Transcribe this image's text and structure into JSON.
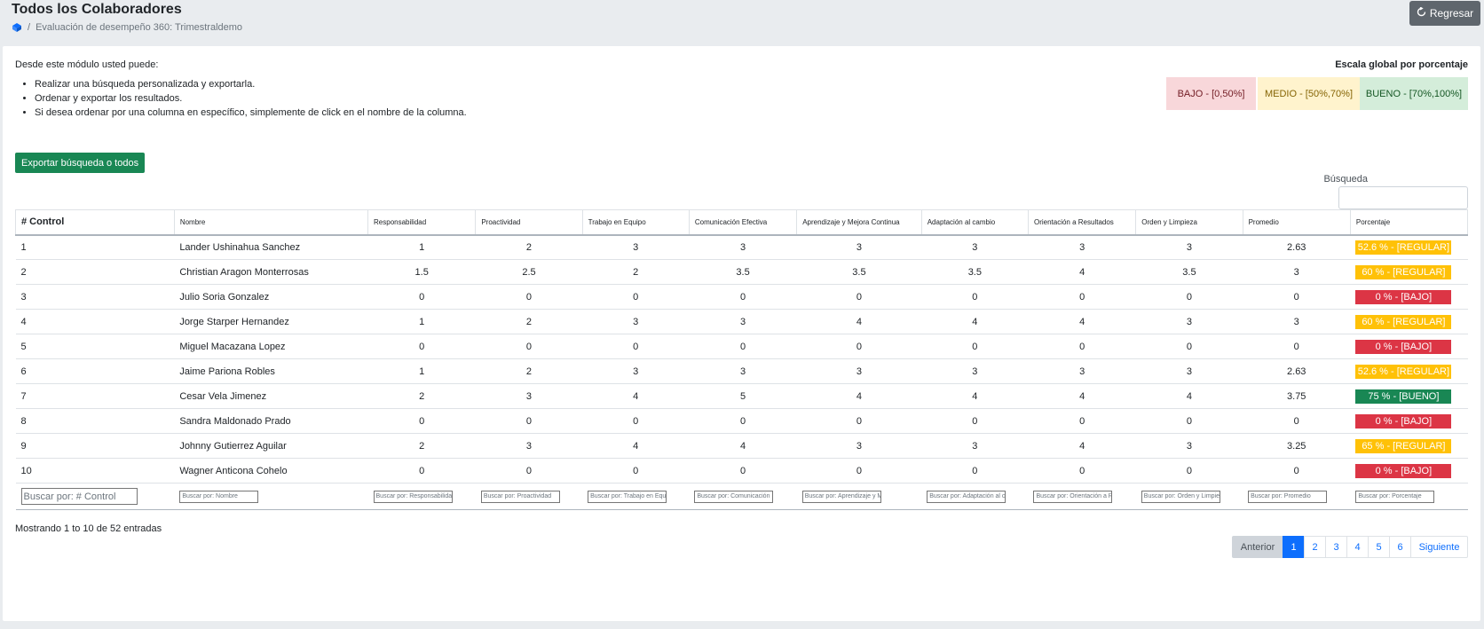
{
  "header": {
    "title": "Todos los Colaboradores",
    "breadcrumb": "Evaluación de desempeño 360: Trimestraldemo",
    "back_label": "Regresar"
  },
  "intro": {
    "lead": "Desde este módulo usted puede:",
    "items": [
      "Realizar una búsqueda personalizada y exportarla.",
      "Ordenar y exportar los resultados.",
      "Si desea ordenar por una columna en específico, simplemente de click en el nombre de la columna."
    ]
  },
  "scale": {
    "title": "Escala global por porcentaje",
    "bajo": "BAJO - [0,50%]",
    "medio": "MEDIO - [50%,70%]",
    "bueno": "BUENO - [70%,100%]",
    "colors": {
      "bajo": "#f8d7da",
      "medio": "#fff3cd",
      "bueno": "#d4edda"
    }
  },
  "export_label": "Exportar búsqueda o todos",
  "search": {
    "label": "Búsqueda",
    "value": ""
  },
  "table": {
    "columns": [
      "# Control",
      "Nombre",
      "Responsabilidad",
      "Proactividad",
      "Trabajo en Equipo",
      "Comunicación Efectiva",
      "Aprendizaje y Mejora Continua",
      "Adaptación al cambio",
      "Orientación a Resultados",
      "Orden y Limpieza",
      "Promedio",
      "Porcentaje"
    ],
    "rows": [
      [
        "1",
        "Lander Ushinahua Sanchez",
        "1",
        "2",
        "3",
        "3",
        "3",
        "3",
        "3",
        "3",
        "2.63",
        "52.6 % - [REGULAR]"
      ],
      [
        "2",
        "Christian Aragon Monterrosas",
        "1.5",
        "2.5",
        "2",
        "3.5",
        "3.5",
        "3.5",
        "4",
        "3.5",
        "3",
        "60 % - [REGULAR]"
      ],
      [
        "3",
        "Julio Soria Gonzalez",
        "0",
        "0",
        "0",
        "0",
        "0",
        "0",
        "0",
        "0",
        "0",
        "0 % - [BAJO]"
      ],
      [
        "4",
        "Jorge Starper Hernandez",
        "1",
        "2",
        "3",
        "3",
        "4",
        "4",
        "4",
        "3",
        "3",
        "60 % - [REGULAR]"
      ],
      [
        "5",
        "Miguel Macazana Lopez",
        "0",
        "0",
        "0",
        "0",
        "0",
        "0",
        "0",
        "0",
        "0",
        "0 % - [BAJO]"
      ],
      [
        "6",
        "Jaime Pariona Robles",
        "1",
        "2",
        "3",
        "3",
        "3",
        "3",
        "3",
        "3",
        "2.63",
        "52.6 % - [REGULAR]"
      ],
      [
        "7",
        "Cesar Vela Jimenez",
        "2",
        "3",
        "4",
        "5",
        "4",
        "4",
        "4",
        "4",
        "3.75",
        "75 % - [BUENO]"
      ],
      [
        "8",
        "Sandra Maldonado Prado",
        "0",
        "0",
        "0",
        "0",
        "0",
        "0",
        "0",
        "0",
        "0",
        "0 % - [BAJO]"
      ],
      [
        "9",
        "Johnny Gutierrez Aguilar",
        "2",
        "3",
        "4",
        "4",
        "3",
        "3",
        "4",
        "3",
        "3.25",
        "65 % - [REGULAR]"
      ],
      [
        "10",
        "Wagner Anticona Cohelo",
        "0",
        "0",
        "0",
        "0",
        "0",
        "0",
        "0",
        "0",
        "0",
        "0 % - [BAJO]"
      ]
    ],
    "status": [
      "regular",
      "regular",
      "bajo",
      "regular",
      "bajo",
      "regular",
      "bueno",
      "bajo",
      "regular",
      "bajo"
    ],
    "filters": [
      "Buscar por: # Control",
      "Buscar por: Nombre",
      "Buscar por: Responsabilida",
      "Buscar por: Proactividad",
      "Buscar por: Trabajo en Equ",
      "Buscar por: Comunicación",
      "Buscar por: Aprendizaje y M",
      "Buscar por: Adaptación al c",
      "Buscar por: Orientación a R",
      "Buscar por: Orden y Limpie",
      "Buscar por: Promedio",
      "Buscar por: Porcentaje"
    ]
  },
  "footer": {
    "info": "Mostrando 1 to 10 de 52 entradas",
    "prev": "Anterior",
    "pages": [
      "1",
      "2",
      "3",
      "4",
      "5",
      "6"
    ],
    "active_page": "1",
    "next": "Siguiente"
  },
  "colors": {
    "regular": "#ffc107",
    "bajo": "#dc3545",
    "bueno": "#198754",
    "export": "#198754",
    "active_page": "#0d6efd"
  }
}
